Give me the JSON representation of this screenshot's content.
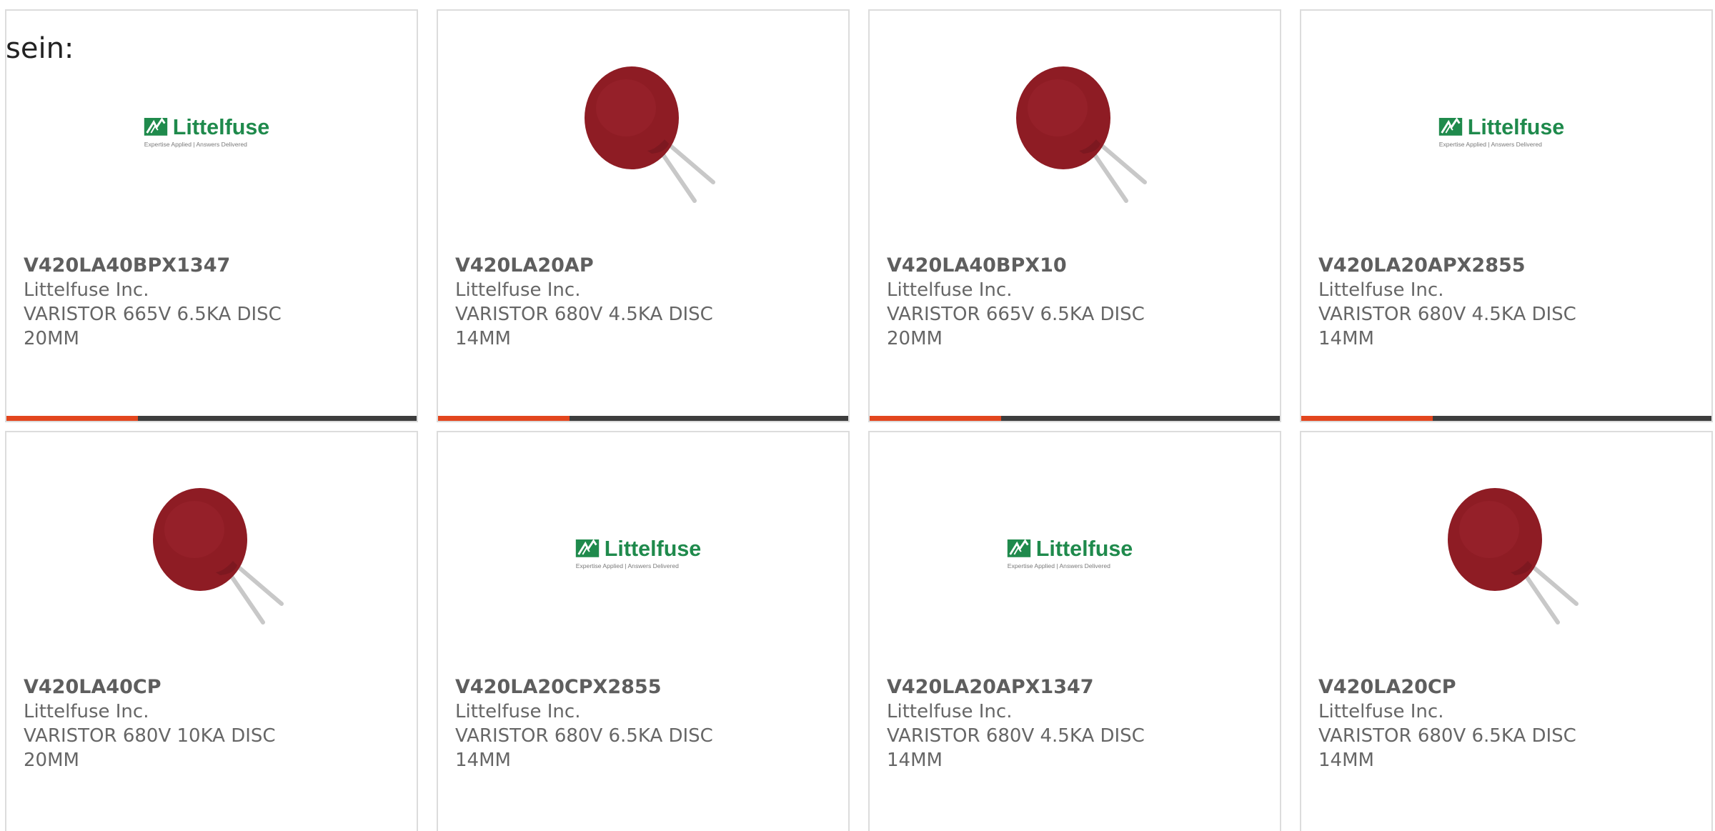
{
  "intro": {
    "text": "sein:"
  },
  "colors": {
    "accent": "#e3461e",
    "bar": "#3d3d3d",
    "logo_green": "#1f8a4c",
    "varistor_red": "#8e1c24"
  },
  "products": [
    {
      "part_number": "V420LA40BPX1347",
      "manufacturer": "Littelfuse Inc.",
      "desc_line1": "VARISTOR 665V 6.5KA DISC",
      "desc_line2": "20MM",
      "image": "littelfuse-logo",
      "logo": {
        "brand": "Littelfuse",
        "tagline": "Expertise Applied | Answers Delivered"
      },
      "progress": 0.32
    },
    {
      "part_number": "V420LA20AP",
      "manufacturer": "Littelfuse Inc.",
      "desc_line1": "VARISTOR 680V 4.5KA DISC",
      "desc_line2": "14MM",
      "image": "varistor-photo",
      "logo": {
        "brand": "",
        "tagline": ""
      },
      "progress": 0.32
    },
    {
      "part_number": "V420LA40BPX10",
      "manufacturer": "Littelfuse Inc.",
      "desc_line1": "VARISTOR 665V 6.5KA DISC",
      "desc_line2": "20MM",
      "image": "varistor-photo",
      "logo": {
        "brand": "",
        "tagline": ""
      },
      "progress": 0.32
    },
    {
      "part_number": "V420LA20APX2855",
      "manufacturer": "Littelfuse Inc.",
      "desc_line1": "VARISTOR 680V 4.5KA DISC",
      "desc_line2": "14MM",
      "image": "littelfuse-logo",
      "logo": {
        "brand": "Littelfuse",
        "tagline": "Expertise Applied | Answers Delivered"
      },
      "progress": 0.32
    },
    {
      "part_number": "V420LA40CP",
      "manufacturer": "Littelfuse Inc.",
      "desc_line1": "VARISTOR 680V 10KA DISC",
      "desc_line2": "20MM",
      "image": "varistor-photo",
      "logo": {
        "brand": "",
        "tagline": ""
      },
      "progress": 0
    },
    {
      "part_number": "V420LA20CPX2855",
      "manufacturer": "Littelfuse Inc.",
      "desc_line1": "VARISTOR 680V 6.5KA DISC",
      "desc_line2": "14MM",
      "image": "littelfuse-logo",
      "logo": {
        "brand": "Littelfuse",
        "tagline": "Expertise Applied | Answers Delivered"
      },
      "progress": 0
    },
    {
      "part_number": "V420LA20APX1347",
      "manufacturer": "Littelfuse Inc.",
      "desc_line1": "VARISTOR 680V 4.5KA DISC",
      "desc_line2": "14MM",
      "image": "littelfuse-logo",
      "logo": {
        "brand": "Littelfuse",
        "tagline": "Expertise Applied | Answers Delivered"
      },
      "progress": 0
    },
    {
      "part_number": "V420LA20CP",
      "manufacturer": "Littelfuse Inc.",
      "desc_line1": "VARISTOR 680V 6.5KA DISC",
      "desc_line2": "14MM",
      "image": "varistor-photo",
      "logo": {
        "brand": "",
        "tagline": ""
      },
      "progress": 0
    }
  ]
}
